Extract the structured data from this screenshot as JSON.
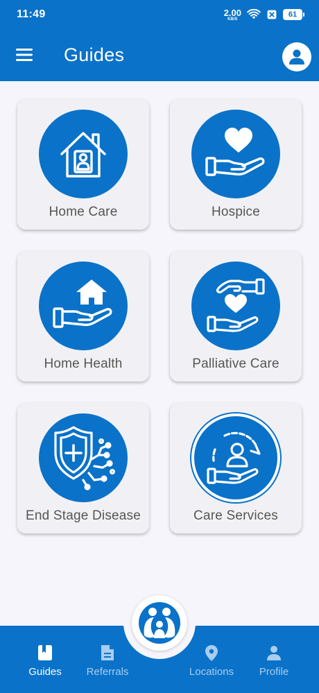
{
  "status_bar": {
    "time": "11:49",
    "net_speed": "2.00",
    "net_unit": "KB/S",
    "battery": "61"
  },
  "app_bar": {
    "title": "Guides"
  },
  "cards": [
    {
      "label": "Home Care",
      "icon": "house-person-icon"
    },
    {
      "label": "Hospice",
      "icon": "hand-heart-icon"
    },
    {
      "label": "Home Health",
      "icon": "hand-house-icon"
    },
    {
      "label": "Palliative Care",
      "icon": "hands-heart-icon"
    },
    {
      "label": "End Stage Disease",
      "icon": "shield-virus-icon"
    },
    {
      "label": "Care Services",
      "icon": "care-cycle-icon"
    }
  ],
  "bottom_nav": {
    "items": [
      {
        "label": "Guides",
        "icon": "book-icon",
        "active": true
      },
      {
        "label": "Referrals",
        "icon": "document-icon",
        "active": false
      },
      {
        "label": "Locations",
        "icon": "location-pin-icon",
        "active": false
      },
      {
        "label": "Profile",
        "icon": "person-icon",
        "active": false
      }
    ]
  },
  "colors": {
    "primary": "#0a72c8",
    "background": "#f5f5fb",
    "card": "#f1f1f5",
    "label": "#555555",
    "nav_inactive": "#a9cdef"
  }
}
